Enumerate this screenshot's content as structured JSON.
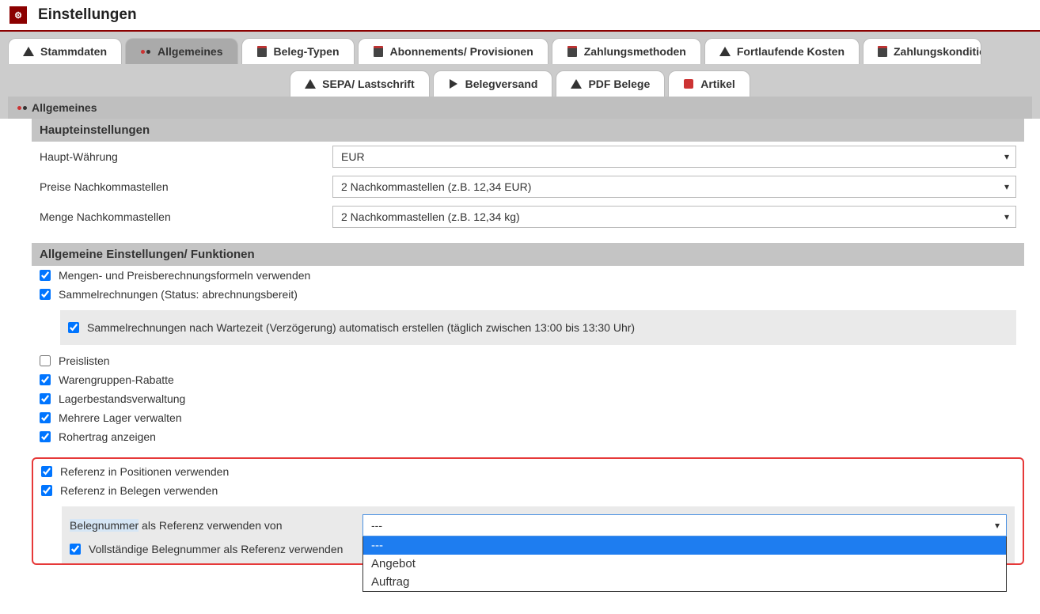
{
  "header": {
    "title": "Einstellungen"
  },
  "tabs_row1": [
    {
      "label": "Stammdaten",
      "icon": "cone"
    },
    {
      "label": "Allgemeines",
      "icon": "dots",
      "active": true
    },
    {
      "label": "Beleg-Typen",
      "icon": "doc"
    },
    {
      "label": "Abonnements/ Provisionen",
      "icon": "doc"
    },
    {
      "label": "Zahlungsmethoden",
      "icon": "doc"
    },
    {
      "label": "Fortlaufende Kosten",
      "icon": "cone"
    },
    {
      "label": "Zahlungskonditionen",
      "icon": "doc"
    }
  ],
  "tabs_row2": [
    {
      "label": "SEPA/ Lastschrift",
      "icon": "cone"
    },
    {
      "label": "Belegversand",
      "icon": "arrow"
    },
    {
      "label": "PDF Belege",
      "icon": "cone"
    },
    {
      "label": "Artikel",
      "icon": "bag"
    }
  ],
  "section_title": "Allgemeines",
  "panel_main": {
    "header": "Haupteinstellungen",
    "rows": {
      "currency": {
        "label": "Haupt-Währung",
        "value": "EUR"
      },
      "price_dec": {
        "label": "Preise Nachkommastellen",
        "value": "2 Nachkommastellen (z.B. 12,34 EUR)"
      },
      "qty_dec": {
        "label": "Menge Nachkommastellen",
        "value": "2 Nachkommastellen (z.B. 12,34 kg)"
      }
    }
  },
  "panel_general": {
    "header": "Allgemeine Einstellungen/ Funktionen",
    "checks": {
      "formulas": "Mengen- und Preisberechnungsformeln verwenden",
      "collective": "Sammelrechnungen (Status: abrechnungsbereit)",
      "collective_sub": "Sammelrechnungen nach Wartezeit (Verzögerung) automatisch erstellen (täglich zwischen 13:00 bis 13:30 Uhr)",
      "pricelists": "Preislisten",
      "group_discounts": "Warengruppen-Rabatte",
      "stock": "Lagerbestandsverwaltung",
      "multi_stock": "Mehrere Lager verwalten",
      "margin": "Rohertrag anzeigen"
    }
  },
  "highlight": {
    "ref_positions": "Referenz in Positionen verwenden",
    "ref_docs": "Referenz in Belegen verwenden",
    "ref_from_label_prefix": "Belegnummer",
    "ref_from_label_suffix": " als Referenz verwenden von",
    "select_value": "---",
    "full_ref": "Vollständige Belegnummer als Referenz verwenden",
    "options": [
      "---",
      "Angebot",
      "Auftrag"
    ]
  }
}
